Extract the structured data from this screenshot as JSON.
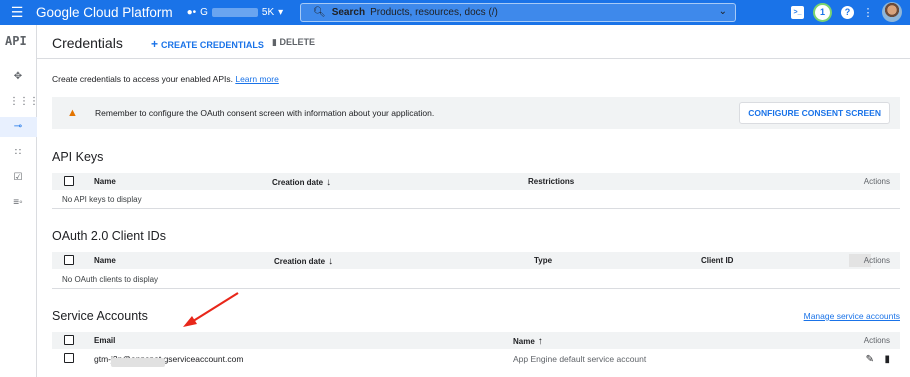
{
  "topbar": {
    "menu_icon": "menu-icon",
    "brand": "Google Cloud Platform",
    "project_name_prefix": "G",
    "project_name_suffix": "5K",
    "search_label": "Search",
    "search_placeholder": "Products, resources, docs (/)",
    "notification_count": "1",
    "colors": {
      "bar": "#1a73e8"
    }
  },
  "sidebar": {
    "logo": "API",
    "items": [
      "dashboard-icon",
      "library-icon",
      "credentials-key-icon",
      "consent-icon",
      "domain-icon",
      "settings-icon"
    ]
  },
  "header": {
    "title": "Credentials",
    "create_label": "CREATE CREDENTIALS",
    "delete_label": "DELETE"
  },
  "intro": {
    "text": "Create credentials to access your enabled APIs.",
    "link": "Learn more"
  },
  "notice": {
    "message": "Remember to configure the OAuth consent screen with information about your application.",
    "button": "CONFIGURE CONSENT SCREEN"
  },
  "api_keys": {
    "title": "API Keys",
    "columns": [
      "Name",
      "Creation date",
      "Restrictions",
      "Actions"
    ],
    "empty": "No API keys to display"
  },
  "oauth": {
    "title": "OAuth 2.0 Client IDs",
    "columns": [
      "Name",
      "Creation date",
      "Type",
      "Client ID",
      "Actions"
    ],
    "empty": "No OAuth clients to display"
  },
  "service_accounts": {
    "title": "Service Accounts",
    "manage_link": "Manage service accounts",
    "columns": [
      "Email",
      "Name",
      "Actions"
    ],
    "rows": [
      {
        "email_prefix": "gtm-",
        "email_suffix": "j2n@appspot.gserviceaccount.com",
        "name": "App Engine default service account"
      }
    ]
  }
}
